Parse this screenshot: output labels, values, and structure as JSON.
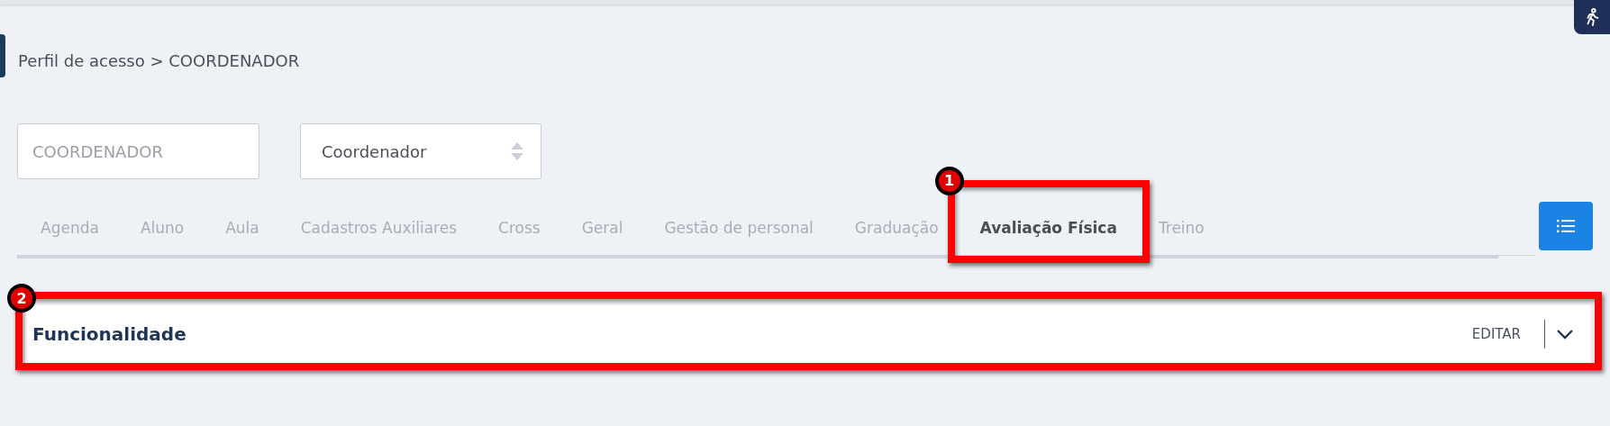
{
  "breadcrumb": "Perfil de acesso > COORDENADOR",
  "name_field": {
    "placeholder": "COORDENADOR"
  },
  "type_select": {
    "value": "Coordenador"
  },
  "tabs": [
    {
      "label": "Agenda",
      "selected": false
    },
    {
      "label": "Aluno",
      "selected": false
    },
    {
      "label": "Aula",
      "selected": false
    },
    {
      "label": "Cadastros Auxiliares",
      "selected": false
    },
    {
      "label": "Cross",
      "selected": false
    },
    {
      "label": "Geral",
      "selected": false
    },
    {
      "label": "Gestão de personal",
      "selected": false
    },
    {
      "label": "Graduação",
      "selected": false
    },
    {
      "label": "Avaliação Física",
      "selected": true,
      "marker": "1"
    },
    {
      "label": "Treino",
      "selected": false
    }
  ],
  "panel": {
    "title": "Funcionalidade",
    "action": "EDITAR",
    "expanded": false,
    "marker": "2"
  }
}
